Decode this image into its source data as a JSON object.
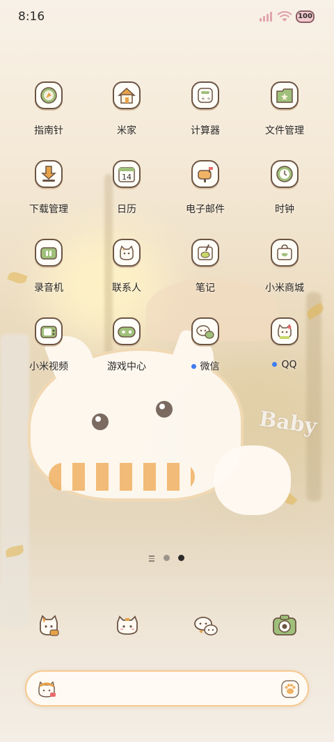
{
  "status_bar": {
    "time": "8:16",
    "battery": "100",
    "colors": {
      "signal": "#e0a4ad",
      "battery_fill": "#f3c9d0"
    }
  },
  "apps": [
    {
      "label": "指南针",
      "icon": "compass-icon",
      "dot": false
    },
    {
      "label": "米家",
      "icon": "home-icon",
      "dot": false
    },
    {
      "label": "计算器",
      "icon": "calculator-icon",
      "dot": false
    },
    {
      "label": "文件管理",
      "icon": "folder-icon",
      "dot": false
    },
    {
      "label": "下载管理",
      "icon": "download-icon",
      "dot": false
    },
    {
      "label": "日历",
      "icon": "calendar-icon",
      "dot": false,
      "icon_text": "14"
    },
    {
      "label": "电子邮件",
      "icon": "mailbox-icon",
      "dot": false
    },
    {
      "label": "时钟",
      "icon": "clock-icon",
      "dot": false
    },
    {
      "label": "录音机",
      "icon": "recorder-icon",
      "dot": false
    },
    {
      "label": "联系人",
      "icon": "contacts-cat-icon",
      "dot": false
    },
    {
      "label": "笔记",
      "icon": "notes-icon",
      "dot": false
    },
    {
      "label": "小米商城",
      "icon": "shopping-bag-icon",
      "dot": false
    },
    {
      "label": "小米视频",
      "icon": "tv-icon",
      "dot": false
    },
    {
      "label": "游戏中心",
      "icon": "gamepad-icon",
      "dot": false
    },
    {
      "label": "微信",
      "icon": "wechat-cat-icon",
      "dot": true
    },
    {
      "label": "QQ",
      "icon": "qq-cat-icon",
      "dot": true
    }
  ],
  "dock": [
    {
      "name": "phone-cat-icon"
    },
    {
      "name": "messages-cat-icon"
    },
    {
      "name": "browser-cats-icon"
    },
    {
      "name": "camera-icon"
    }
  ],
  "pager": {
    "pages": 2,
    "current": 2
  },
  "search": {
    "left_icon": "cat-avatar-icon",
    "right_icon": "paw-icon"
  },
  "colors": {
    "accent": "#f6c990",
    "badge_dot": "#3f7cf0",
    "outline": "#6b5443"
  }
}
